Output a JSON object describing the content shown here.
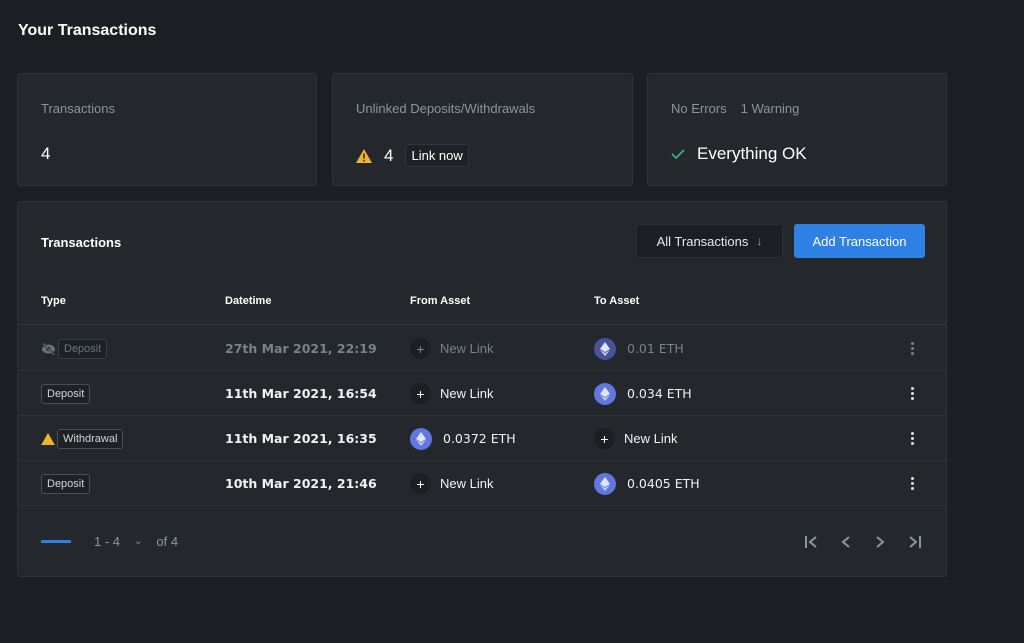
{
  "page": {
    "title": "Your Transactions"
  },
  "summary": {
    "transactions": {
      "label": "Transactions",
      "value": "4"
    },
    "unlinked": {
      "label": "Unlinked Deposits/Withdrawals",
      "value": "4",
      "action": "Link now",
      "icon": "warning-icon",
      "icon_color": "#f0b429"
    },
    "status": {
      "errors": "No Errors",
      "warnings": "1 Warning",
      "value": "Everything OK",
      "icon": "check-icon",
      "icon_color": "#2fbf71"
    }
  },
  "panel": {
    "title": "Transactions",
    "filter": {
      "label": "All Transactions",
      "icon": "arrow-down-icon"
    },
    "add_button": "Add Transaction",
    "accent": "#2f80e4",
    "columns": [
      "Type",
      "Datetime",
      "From Asset",
      "To Asset"
    ],
    "rows": [
      {
        "type": "Deposit",
        "type_icon": "eye-off-icon",
        "datetime": "27th Mar 2021, 22:19",
        "from": "New Link",
        "from_kind": "link",
        "to": "0.01 ETH",
        "to_kind": "eth",
        "dimmed": true
      },
      {
        "type": "Deposit",
        "type_icon": "",
        "datetime": "11th Mar 2021, 16:54",
        "from": "New Link",
        "from_kind": "link",
        "to": "0.034 ETH",
        "to_kind": "eth",
        "dimmed": false
      },
      {
        "type": "Withdrawal",
        "type_icon": "warning-icon",
        "datetime": "11th Mar 2021, 16:35",
        "from": "0.0372 ETH",
        "from_kind": "eth",
        "to": "New Link",
        "to_kind": "link",
        "dimmed": false
      },
      {
        "type": "Deposit",
        "type_icon": "",
        "datetime": "10th Mar 2021, 21:46",
        "from": "New Link",
        "from_kind": "link",
        "to": "0.0405 ETH",
        "to_kind": "eth",
        "dimmed": false
      }
    ],
    "pagination": {
      "range": "1 - 4",
      "total": "of 4",
      "buttons": [
        "first-page",
        "previous-page",
        "next-page",
        "last-page"
      ]
    }
  }
}
